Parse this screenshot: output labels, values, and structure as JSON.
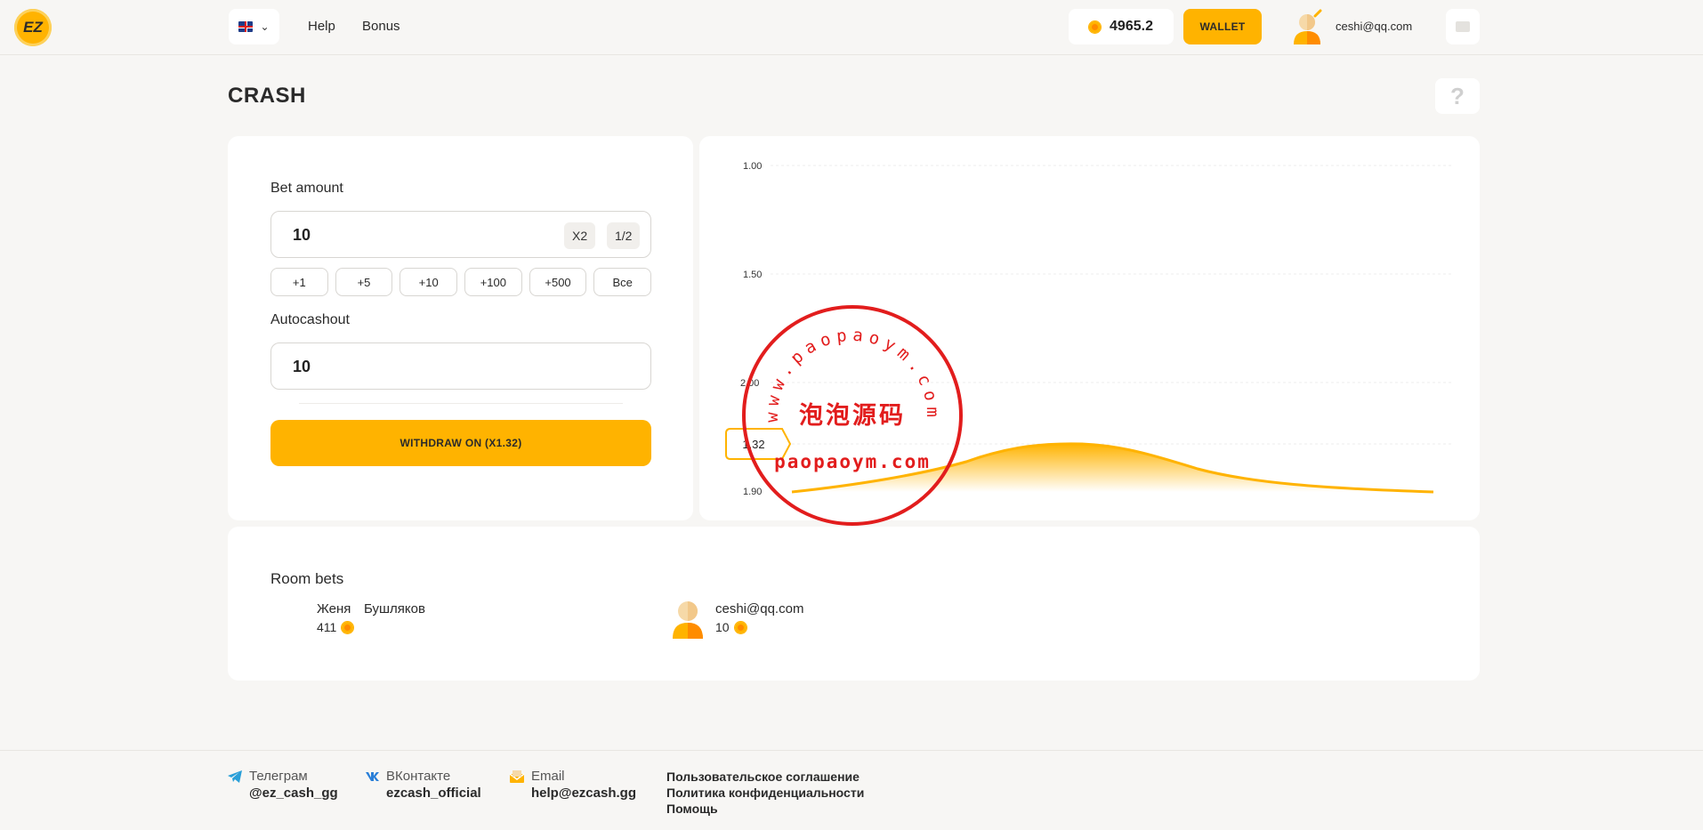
{
  "header": {
    "logo_text": "EZ",
    "language": "en",
    "nav": [
      "Help",
      "Bonus"
    ],
    "balance": "4965.2",
    "wallet_label": "WALLET",
    "user_email": "ceshi@qq.com"
  },
  "page": {
    "title": "CRASH",
    "help_label": "?"
  },
  "bet": {
    "amount_label": "Bet amount",
    "amount_value": "10",
    "x2_label": "X2",
    "half_label": "1/2",
    "quick": [
      "+1",
      "+5",
      "+10",
      "+100",
      "+500",
      "Все"
    ],
    "autocashout_label": "Autocashout",
    "autocashout_value": "10",
    "withdraw_label": "WITHDRAW ON (X1.32)"
  },
  "chart": {
    "current_multiplier": "1.32",
    "colors": {
      "accent": "#ffb300",
      "line": "#ffb300"
    }
  },
  "chart_data": {
    "type": "area",
    "y_tick_labels": [
      "1.00",
      "1.50",
      "2.00",
      "1.90"
    ],
    "marker_label": "1.32"
  },
  "watermark": {
    "top_text": "www.paopaoym.com",
    "center_text": "泡泡源码",
    "bottom_text": "paopaoym.com"
  },
  "room": {
    "title": "Room bets",
    "bets": [
      {
        "name_first": "Женя",
        "name_last": "Бушляков",
        "amount": "411"
      },
      {
        "name": "ceshi@qq.com",
        "amount": "10"
      }
    ]
  },
  "footer": {
    "telegram_label": "Телеграм",
    "telegram_value": "@ez_cash_gg",
    "vk_label": "ВКонтакте",
    "vk_value": "ezcash_official",
    "email_label": "Email",
    "email_value": "help@ezcash.gg",
    "links": [
      "Пользовательское соглашение",
      "Политика конфиденциальности",
      "Помощь"
    ]
  }
}
